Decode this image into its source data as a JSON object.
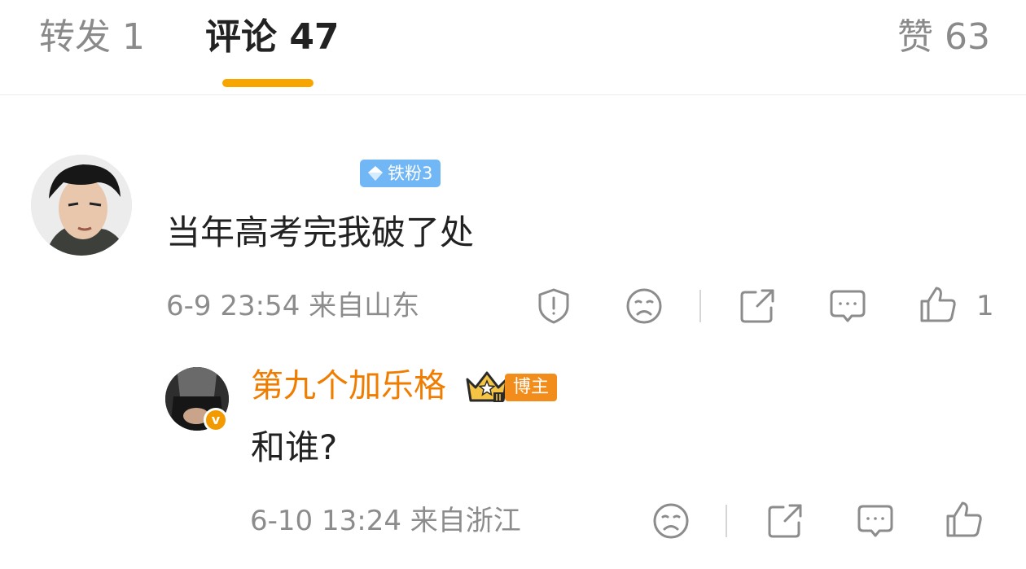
{
  "tabs": [
    {
      "label": "转发 1"
    },
    {
      "label": "评论 47"
    },
    {
      "label": "赞 63"
    }
  ],
  "comment": {
    "fan_badge": "铁粉3",
    "text": "当年高考完我破了处",
    "meta": "6-9 23:54 来自山东",
    "like_count": "1"
  },
  "reply": {
    "author": "第九个加乐格",
    "verified_mark": "v",
    "badge": "博主",
    "text": "和谁?",
    "meta": "6-10 13:24 来自浙江"
  },
  "colors": {
    "accent": "#f7a600",
    "author_orange": "#f07d00",
    "fan_badge_blue": "#71b7f5",
    "icon_gray": "#8c8c8c"
  },
  "icons": [
    "report-icon",
    "dislike-icon",
    "share-icon",
    "reply-icon",
    "like-icon",
    "crown-icon",
    "diamond-icon"
  ]
}
